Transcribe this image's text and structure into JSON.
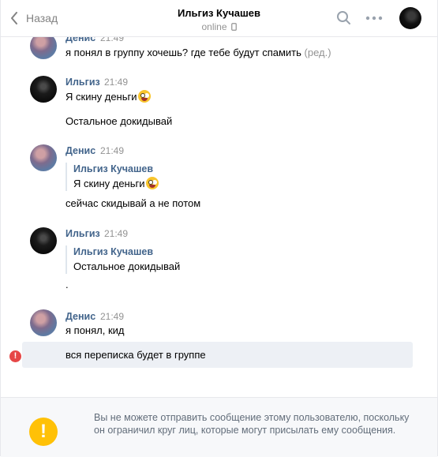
{
  "header": {
    "back_label": "Назад",
    "title": "Ильгиз Кучашев",
    "status": "online"
  },
  "messages": [
    {
      "author": "Денис",
      "time": "21:49",
      "text": "я понял в группу хочешь? где тебе будут спамить",
      "edited": "(ред.)"
    },
    {
      "author": "Ильгиз",
      "time": "21:49",
      "text": "Я скину деньги",
      "text2": "Остальное докидывай"
    },
    {
      "author": "Денис",
      "time": "21:49",
      "quote_author": "Ильгиз Кучашев",
      "quote_text": "Я скину деньги",
      "text": "сейчас скидывай а не потом"
    },
    {
      "author": "Ильгиз",
      "time": "21:49",
      "quote_author": "Ильгиз Кучашев",
      "quote_text": "Остальное докидывай",
      "text": "."
    },
    {
      "author": "Денис",
      "time": "21:49",
      "text": "я понял, кид",
      "failed_text": "вся переписка будет в группе"
    }
  ],
  "footer": {
    "warning": "Вы не можете отправить сообщение этому пользователю, поскольку он ограничил круг лиц, которые могут присылать ему сообщения.",
    "warning_icon": "!"
  },
  "error_icon": "!",
  "icons": [
    "back-chevron-icon",
    "search-icon",
    "more-icon",
    "mobile-icon",
    "emoji-icon",
    "error-icon",
    "warning-icon"
  ],
  "colors": {
    "link": "#42648b",
    "muted": "#939393",
    "error": "#e64646",
    "warning": "#ffc107",
    "failed_bg": "#edf0f5"
  }
}
